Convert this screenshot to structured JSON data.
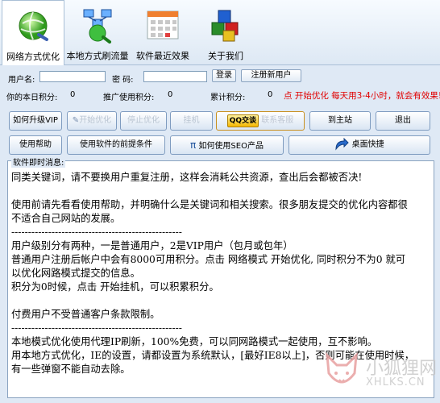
{
  "toolbar": {
    "tabs": [
      {
        "label": "网络方式优化",
        "icon": "globe-icon"
      },
      {
        "label": "本地方式刷流量",
        "icon": "network-icon"
      },
      {
        "label": "软件最近效果",
        "icon": "calendar-icon"
      },
      {
        "label": "关于我们",
        "icon": "cubes-icon"
      }
    ]
  },
  "login": {
    "username_label": "用户名:",
    "username_value": "",
    "password_label": "密  码:",
    "password_value": "",
    "login_button": "登录",
    "register_button": "注册新用户"
  },
  "stats": {
    "today_label": "你的本日积分:",
    "today_value": "0",
    "referral_label": "推广使用积分:",
    "referral_value": "0",
    "total_label": "累计积分:",
    "total_value": "0",
    "notice": "点 开始优化 每天用3-4小时，就会有效果!"
  },
  "buttons": {
    "upgrade_vip": "如何升级VIP",
    "disabled_1": "开始优化",
    "disabled_2": "停止优化",
    "disabled_3": "挂机",
    "qq_badge": "QQ交谈",
    "contact": "联系客服",
    "main_site": "到主站",
    "exit": "退出",
    "help": "使用帮助",
    "prerequisites": "使用软件的前提条件",
    "seo_products": "如何使用SEO产品",
    "desktop_shortcut": "桌面快捷"
  },
  "messages": {
    "title": "软件即时消息:",
    "lines": [
      "同类关键词，请不要换用户重复注册，这样会消耗公共资源，查出后会都被否决!",
      "",
      "使用前请先看看使用帮助，并明确什么是关键词和相关搜索。很多朋友提交的优化内容都很",
      "不适合自己网站的发展。",
      "---------------------------------------------------",
      "用户级别分有两种，一是普通用户，2是VIP用户（包月或包年）",
      "普通用户注册后帐户中会有8000可用积分。点击 网络模式 开始优化, 同时积分不为0 就可",
      "以优化网路模式提交的信息。",
      "积分为0时候，点击 开始挂机，可以积累积分。",
      "",
      "付费用户不受普通客户条款限制。",
      "---------------------------------------------------",
      "本地模式优化使用代理IP刷新，100%免费，可以同网路模式一起使用，互不影响。",
      "用本地方式优化，IE的设置，请都设置为系统默认，[最好IE8以上]，否则可能在使用时候，",
      "有一些弹窗不能自动去除。"
    ]
  },
  "watermark": {
    "title": "小狐狸网",
    "url": "XHLKS.CN"
  },
  "colors": {
    "accent_red": "#e00000",
    "panel_bg": "#dfe9f5"
  }
}
